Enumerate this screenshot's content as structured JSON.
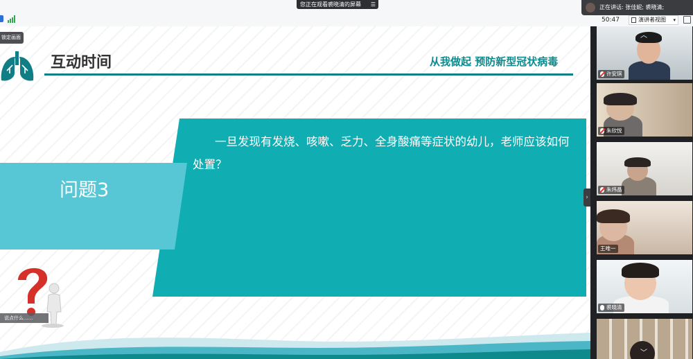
{
  "toolbar": {
    "share_banner": "您正在观看裘晓清的屏幕",
    "share_menu_icon": "menu-icon",
    "speaker_text": "正在讲话: 张佳妮; 裘晓清;",
    "timer": "50:47",
    "view_mode": "演讲者视图",
    "signal_icon": "signal-bars-icon"
  },
  "slide": {
    "lock_label": "锁定画面",
    "title": "互动时间",
    "subtitle": "从我做起 预防新型冠状病毒",
    "question_label": "问题3",
    "question_text": "一旦发现有发烧、咳嗽、乏力、全身酸痛等症状的幼儿，老师应该如何处置？",
    "caption": "说点什么......",
    "colors": {
      "teal": "#10aeb2",
      "light_teal": "#57c7d6",
      "dark_teal": "#117e86"
    }
  },
  "participants": [
    {
      "name": "许安琪",
      "mic": "off"
    },
    {
      "name": "朱欣悦",
      "mic": "off"
    },
    {
      "name": "朱炜晶",
      "mic": "off"
    },
    {
      "name": "王唯一",
      "mic": "none"
    },
    {
      "name": "裘晓清",
      "mic": "on"
    },
    {
      "name": "",
      "mic": "none"
    }
  ]
}
